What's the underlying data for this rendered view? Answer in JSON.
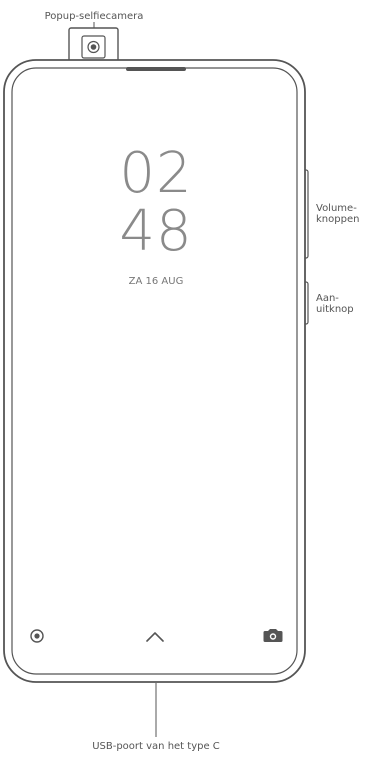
{
  "labels": {
    "popup_camera": "Popup-selfiecamera",
    "volume_line1": "Volume-",
    "volume_line2": "knoppen",
    "power_line1": "Aan-",
    "power_line2": "uitknop",
    "usb_port": "USB-poort van het type C"
  },
  "lockscreen": {
    "hour": "02",
    "minute": "48",
    "date": "ZA 16 AUG"
  },
  "icons": {
    "popup_camera": "camera-lens-icon",
    "earpiece": "earpiece-speaker-icon",
    "shortcut_left": "assistant-circle-icon",
    "swipe_up": "chevron-up-icon",
    "shortcut_right": "camera-icon"
  },
  "colors": {
    "outline": "#555555",
    "clock_text": "#8a8a8a",
    "label_text": "#555555"
  }
}
